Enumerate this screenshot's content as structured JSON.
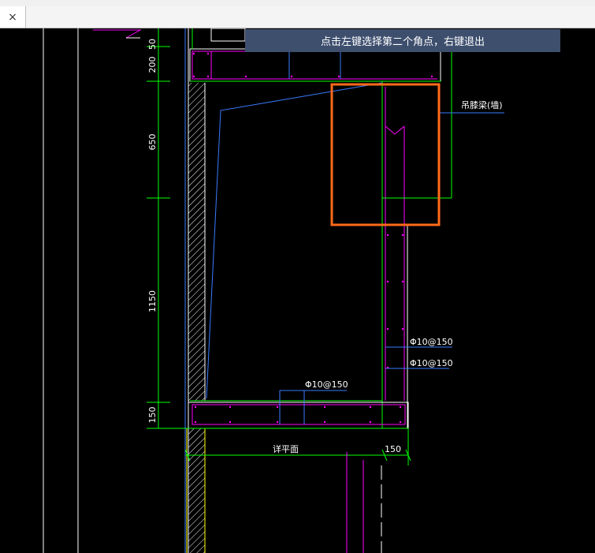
{
  "window": {
    "close_glyph": "×"
  },
  "prompt": {
    "message": "点击左键选择第二个角点，右键退出"
  },
  "drawing": {
    "dimensions": {
      "d50": "50",
      "d200": "200",
      "d650": "650",
      "d1150": "1150",
      "d150_vertical": "150",
      "d150_horizontal": "150"
    },
    "labels": {
      "parapet_label": "吊膝梁(墙)",
      "rebar_1": "Φ10@150",
      "rebar_2": "Φ10@150",
      "rebar_3": "Φ10@150",
      "section_name": "详平面"
    },
    "colors": {
      "background": "#000000",
      "dimension_lines": "#00ff00",
      "rebar": "#ff00ff",
      "outline": "#ffffff",
      "leader": "#2f6bff",
      "selection_box": "#ff6a1a",
      "tooltip": "#3e4f6e"
    }
  }
}
